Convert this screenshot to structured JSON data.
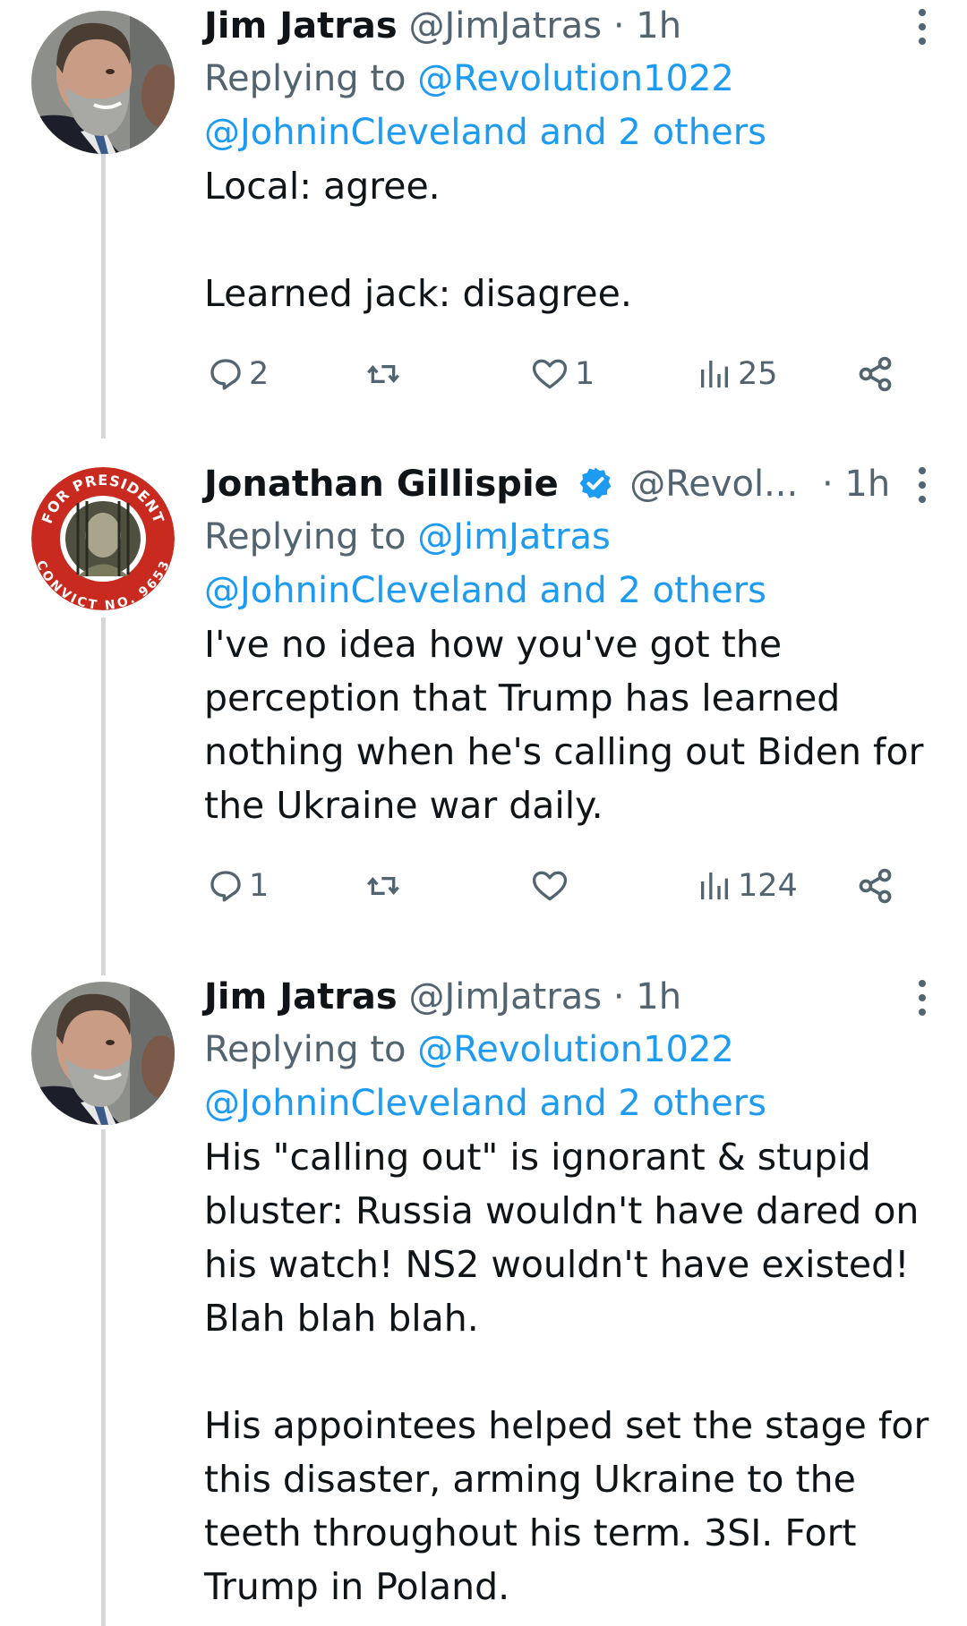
{
  "tweets": [
    {
      "name": "Jim Jatras",
      "handle": "@JimJatras",
      "separator": "·",
      "time": "1h",
      "replying_prefix": "Replying to",
      "replying_to": "@Revolution1022",
      "replying_more": "@JohninCleveland and 2 others",
      "text": "Local: agree.\n\nLearned jack: disagree.",
      "replies": "2",
      "retweets": "",
      "likes": "1",
      "views": "25"
    },
    {
      "name": "Jonathan Gillispie",
      "handle": "@Revol...",
      "separator": "·",
      "time": "1h",
      "replying_prefix": "Replying to",
      "replying_to": "@JimJatras",
      "replying_more": "@JohninCleveland and 2 others",
      "text": "I've no idea how you've got the perception that Trump has learned nothing when he's calling out Biden for the Ukraine war daily.",
      "replies": "1",
      "retweets": "",
      "likes": "",
      "views": "124",
      "avatar_text_top": "FOR PRESIDENT",
      "avatar_text_bottom": "CONVICT NO. 9653"
    },
    {
      "name": "Jim Jatras",
      "handle": "@JimJatras",
      "separator": "·",
      "time": "1h",
      "replying_prefix": "Replying to",
      "replying_to": "@Revolution1022",
      "replying_more": "@JohninCleveland and 2 others",
      "text": "His \"calling out\" is ignorant & stupid bluster: Russia wouldn't have dared on his watch! NS2 wouldn't have existed! Blah blah blah.\n\nHis appointees helped set the stage for this disaster, arming Ukraine to the teeth throughout his term. 3SI. Fort Trump in Poland."
    }
  ],
  "colors": {
    "link": "#1d9bf0",
    "secondary": "#536471",
    "text": "#0f1419",
    "thread_line": "#cfd9de",
    "verified": "#1d9bf0"
  },
  "icons": {
    "reply": "speech-bubble-icon",
    "retweet": "retweet-icon",
    "like": "heart-icon",
    "views": "bar-chart-icon",
    "share": "share-icon",
    "more": "vertical-dots-icon",
    "verified": "verified-badge-icon"
  }
}
